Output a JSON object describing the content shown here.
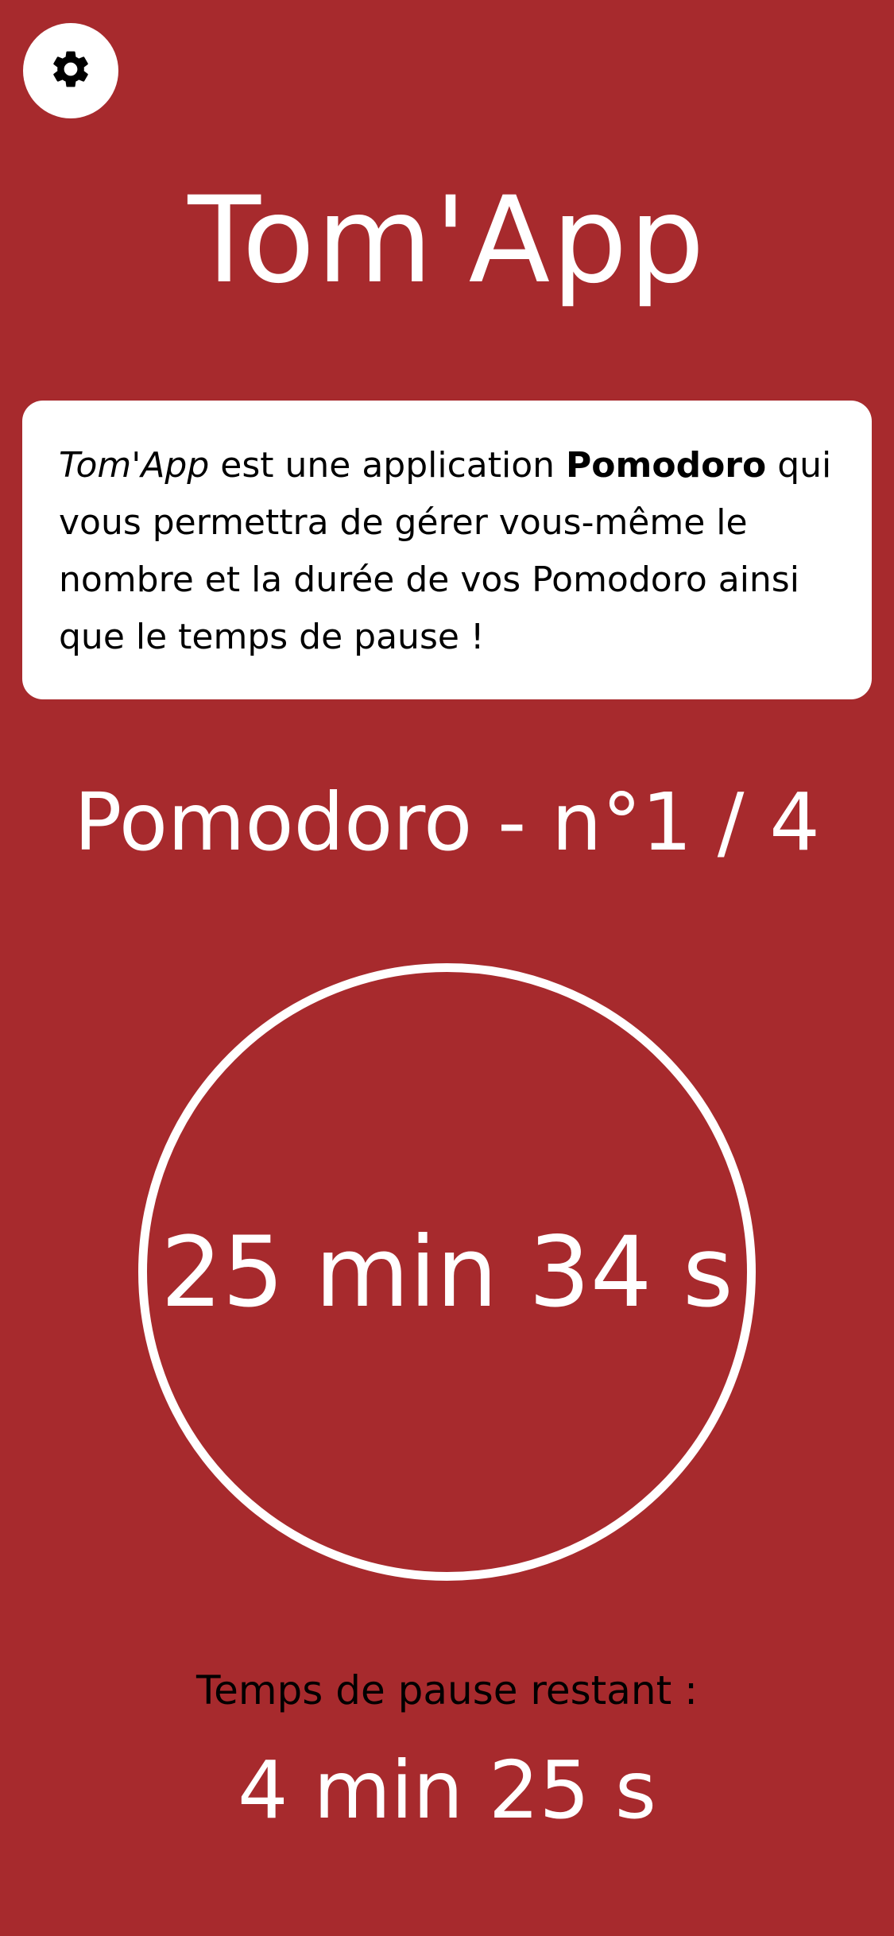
{
  "header": {
    "settings_icon": "gear-icon",
    "app_title": "Tom'App"
  },
  "info": {
    "app_name": "Tom'App",
    "part1": " est une application ",
    "pomodoro_bold": "Pomodoro",
    "part2": " qui vous permettra de gérer vous-même le nombre et la durée de vos Pomodoro ainsi que le temps de pause !"
  },
  "pomodoro": {
    "label": "Pomodoro - n°1 / 4",
    "current": 1,
    "total": 4
  },
  "timer": {
    "value": "25 min 34 s"
  },
  "pause": {
    "label": "Temps de pause restant :",
    "value": "4 min 25 s"
  },
  "colors": {
    "background": "#a72a2d",
    "card": "#ffffff",
    "text_light": "#ffffff",
    "text_dark": "#000000"
  }
}
